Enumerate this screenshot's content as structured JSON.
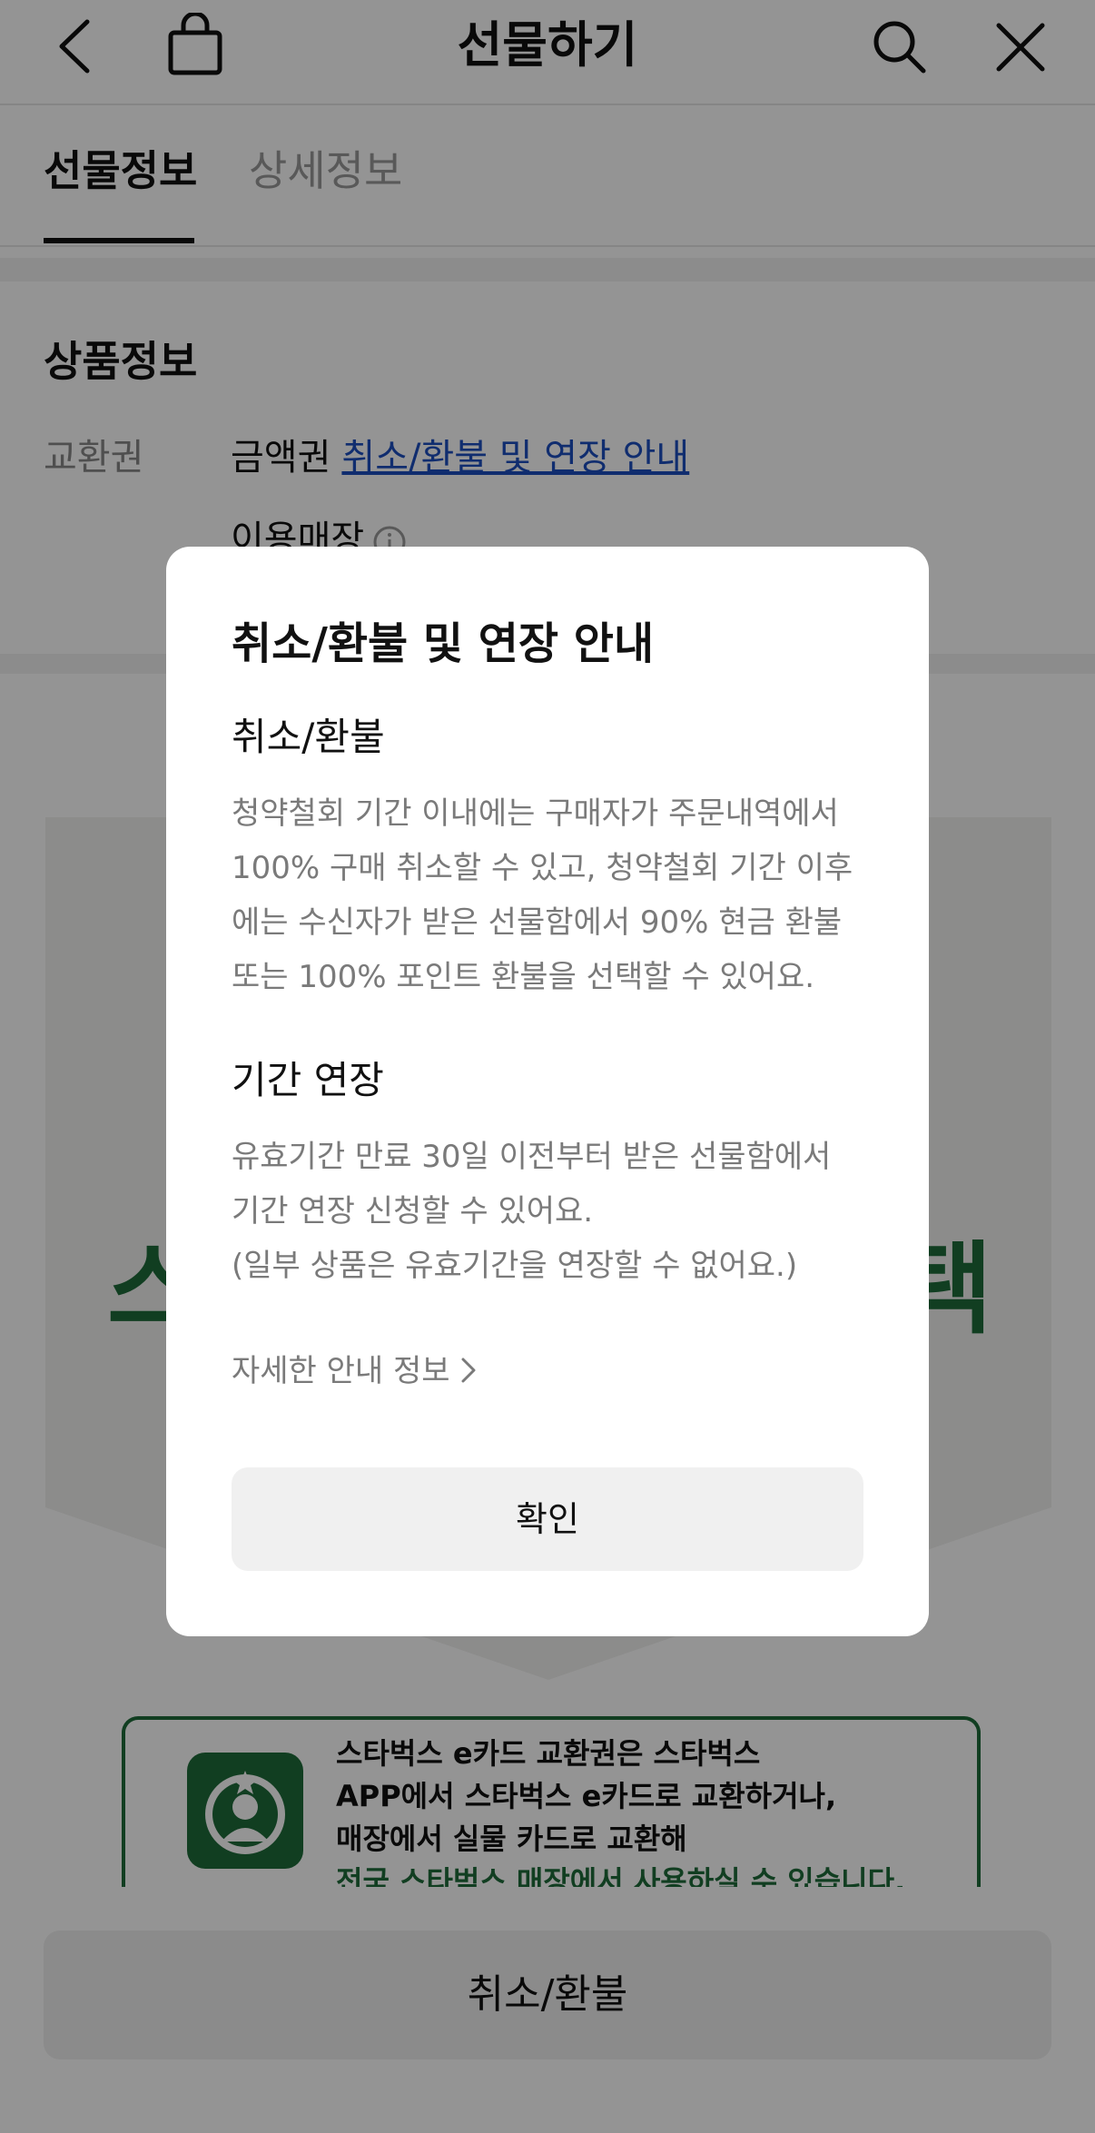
{
  "header": {
    "title": "선물하기",
    "icons": [
      "chevron-left-icon",
      "shopping-bag-icon",
      "search-icon",
      "close-icon"
    ]
  },
  "tabs": [
    {
      "label": "선물정보",
      "active": true
    },
    {
      "label": "상세정보",
      "active": false
    }
  ],
  "product_info": {
    "section_title": "상품정보",
    "exchange_label": "교환권",
    "exchange_value": "금액권",
    "exchange_link": "취소/환불 및 연장 안내",
    "store_label": "이용매장"
  },
  "banner": {
    "text_left": "스",
    "text_right": "택",
    "card_lines": [
      "스타벅스 e카드 교환권은 스타벅스",
      "APP에서 스타벅스 e카드로 교환하거나,",
      "매장에서 실물 카드로 교환해",
      "전국 스타벅스 매장에서 사용하실 수 있습니다."
    ]
  },
  "bottom_button": "취소/환불",
  "modal": {
    "title": "취소/환불 및 연장 안내",
    "cancel_heading": "취소/환불",
    "cancel_lines": [
      "청약철회 기간 이내에는 구매자가 주문내역에서",
      "100% 구매 취소할 수 있고, 청약철회 기간 이후",
      "에는 수신자가 받은 선물함에서 90% 현금 환불",
      "또는 100% 포인트 환불을 선택할 수 있어요."
    ],
    "extend_heading": "기간 연장",
    "extend_lines": [
      "유효기간 만료 30일 이전부터 받은 선물함에서",
      "기간 연장 신청할 수 있어요.",
      "(일부 상품은 유효기간을 연장할 수 없어요.)"
    ],
    "more_info": "자세한 안내 정보",
    "confirm": "확인"
  },
  "colors": {
    "link": "#1d4fbf",
    "brand_green": "#1e6b3a",
    "overlay": "rgba(0,0,0,0.42)"
  }
}
